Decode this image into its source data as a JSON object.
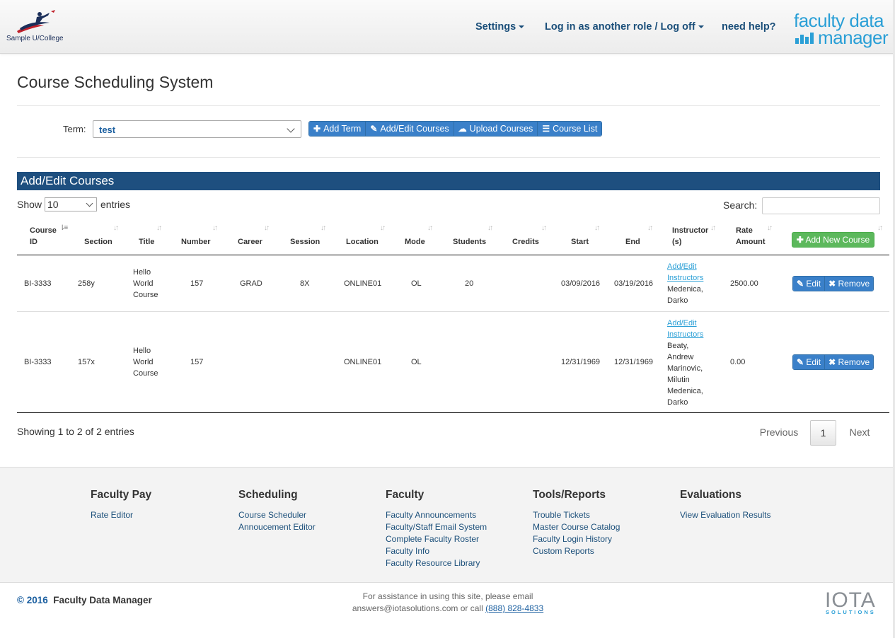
{
  "header": {
    "logo_text": "Sample U/College",
    "nav": {
      "settings": "Settings",
      "role": "Log in as another role / Log off",
      "help": "need help?"
    },
    "brand_line1": "faculty data",
    "brand_line2": "manager"
  },
  "page": {
    "title": "Course Scheduling System",
    "term_label": "Term:",
    "term_value": "test",
    "buttons": {
      "add_term": "Add Term",
      "add_edit_courses": "Add/Edit Courses",
      "upload_courses": "Upload Courses",
      "course_list": "Course List"
    }
  },
  "panel": {
    "title": "Add/Edit Courses",
    "show_label": "Show",
    "length_value": "10",
    "entries_label": "entries",
    "search_label": "Search:",
    "add_new_course": "Add New Course"
  },
  "table": {
    "headers": {
      "course_id_1": "Course",
      "course_id_2": "ID",
      "section": "Section",
      "title": "Title",
      "number": "Number",
      "career": "Career",
      "session": "Session",
      "location": "Location",
      "mode": "Mode",
      "students": "Students",
      "credits": "Credits",
      "start": "Start",
      "end": "End",
      "instructor_1": "Instructor",
      "instructor_2": "(s)",
      "rate_1": "Rate",
      "rate_2": "Amount"
    },
    "rows": [
      {
        "course_id": "BI-3333",
        "section": "258y",
        "title_1": "Hello",
        "title_2": "World",
        "title_3": "Course",
        "number": "157",
        "career": "GRAD",
        "session": "8X",
        "location": "ONLINE01",
        "mode": "OL",
        "students": "20",
        "credits": "",
        "start": "03/09/2016",
        "end": "03/19/2016",
        "instr_link_1": "Add/Edit",
        "instr_link_2": "Instructors",
        "instr_1": "Medenica,",
        "instr_2": "Darko",
        "rate": "2500.00",
        "edit": "Edit",
        "remove": "Remove"
      },
      {
        "course_id": "BI-3333",
        "section": "157x",
        "title_1": "Hello",
        "title_2": "World",
        "title_3": "Course",
        "number": "157",
        "career": "",
        "session": "",
        "location": "ONLINE01",
        "mode": "OL",
        "students": "",
        "credits": "",
        "start": "12/31/1969",
        "end": "12/31/1969",
        "instr_link_1": "Add/Edit",
        "instr_link_2": "Instructors",
        "instr_1": "Beaty,",
        "instr_2": "Andrew",
        "instr_3": "Marinovic,",
        "instr_4": "Milutin",
        "instr_5": "Medenica,",
        "instr_6": "Darko",
        "rate": "0.00",
        "edit": "Edit",
        "remove": "Remove"
      }
    ]
  },
  "pagination": {
    "info": "Showing 1 to 2 of 2 entries",
    "previous": "Previous",
    "current": "1",
    "next": "Next"
  },
  "footer": {
    "columns": [
      {
        "title": "Faculty Pay",
        "links": [
          "Rate Editor"
        ]
      },
      {
        "title": "Scheduling",
        "links": [
          "Course Scheduler",
          "Annoucement Editor"
        ]
      },
      {
        "title": "Faculty",
        "links": [
          "Faculty Announcements",
          "Faculty/Staff Email System",
          "Complete Faculty Roster",
          "Faculty Info",
          "Faculty Resource Library"
        ]
      },
      {
        "title": "Tools/Reports",
        "links": [
          "Trouble Tickets",
          "Master Course Catalog",
          "Faculty Login History",
          "Custom Reports"
        ]
      },
      {
        "title": "Evaluations",
        "links": [
          "View Evaluation Results"
        ]
      }
    ],
    "copyright_year": "© 2016",
    "copyright_name": "Faculty Data Manager",
    "assist_line1": "For assistance in using this site, please email",
    "assist_line2": "answers@iotasolutions.com or call",
    "phone": "(888) 828-4833",
    "iota_word": "IOTA",
    "iota_sub": "SOLUTIONS"
  },
  "colors": {
    "primary_blue": "#3a80c9",
    "panel_header": "#1e4f7f",
    "success_green": "#5cb85c",
    "brand_cyan": "#2a9fd6"
  }
}
